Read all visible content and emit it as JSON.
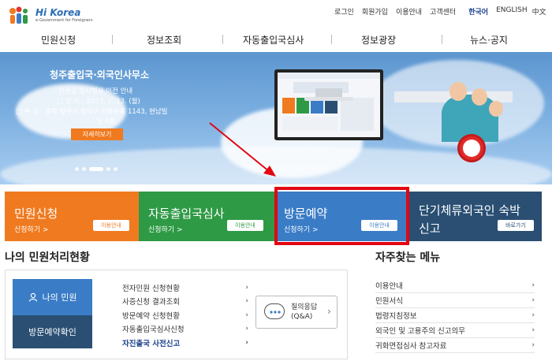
{
  "logo": {
    "title": "Hi Korea",
    "subtitle": "e-Government for Foreigners"
  },
  "util_links": [
    "로그인",
    "회원가입",
    "이용안내",
    "고객센터"
  ],
  "languages": [
    "한국어",
    "ENGLISH",
    "中文"
  ],
  "active_language": "한국어",
  "gnb": [
    "민원신청",
    "정보조회",
    "자동출입국심사",
    "정보광장",
    "뉴스·공지"
  ],
  "banner": {
    "title": "청주출입국·외국인사무소",
    "line1": "민원실 임시청사 이전 안내",
    "line2": "□ 일 시 : 2023. 2. 13. (월)",
    "line3": "□ 주 소 : 충북 청주시 흥덕구 가로수로 1143, 현남빌",
    "line4": "딩 4층",
    "detail_button": "자세히보기",
    "slides": 5,
    "active_slide": 2
  },
  "tiles": [
    {
      "title": "민원신청",
      "sub": "신청하기 >",
      "button": "이용안내",
      "color": "#f07a1f"
    },
    {
      "title": "자동출입국심사",
      "sub": "신청하기 >",
      "button": "이용안내",
      "color": "#2e9a45"
    },
    {
      "title": "방문예약",
      "sub": "신청하기 >",
      "button": "이용안내",
      "color": "#3a7cc6"
    },
    {
      "title": "단기체류외국인 숙박",
      "title2": "신고",
      "sub": "",
      "button": "바로가기",
      "color": "#2a4f73"
    }
  ],
  "my_status": {
    "title": "나의 민원처리현황",
    "my_button": "나의 민원",
    "visit_button": "방문예약확인",
    "items": [
      "전자민원 신청현황",
      "사증신청 결과조회",
      "방문예약 신청현황",
      "자동출입국심사신청",
      "자진출국 사전신고"
    ],
    "qa_label1": "질의응답",
    "qa_label2": "(Q&A)"
  },
  "favorites": {
    "title": "자주찾는 메뉴",
    "items": [
      "이용안내",
      "민원서식",
      "법령지침정보",
      "외국인 및 고용주의 신고의무",
      "귀화면접심사 참고자료"
    ]
  },
  "colors": {
    "highlight": "#e20612",
    "accent": "#1a3f8c"
  }
}
